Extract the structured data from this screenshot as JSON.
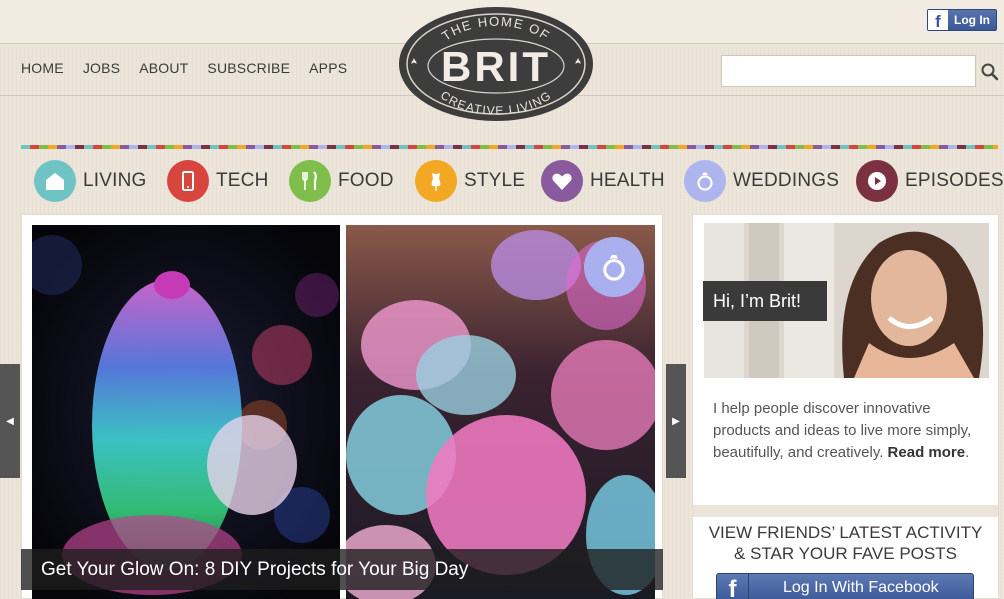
{
  "header": {
    "fb_login_label": "Log In",
    "nav": [
      "HOME",
      "JOBS",
      "ABOUT",
      "SUBSCRIBE",
      "APPS"
    ],
    "logo": {
      "top": "THE HOME OF",
      "main": "BRIT",
      "bottom": "CREATIVE LIVING"
    },
    "search": {
      "value": "",
      "placeholder": ""
    }
  },
  "categories": [
    {
      "label": "LIVING",
      "color": "#6fc3c5",
      "icon": "house-icon"
    },
    {
      "label": "TECH",
      "color": "#d8453e",
      "icon": "phone-icon"
    },
    {
      "label": "FOOD",
      "color": "#7fbe4a",
      "icon": "fork-knife-icon"
    },
    {
      "label": "STYLE",
      "color": "#f3a823",
      "icon": "dress-form-icon"
    },
    {
      "label": "HEALTH",
      "color": "#8a5a9e",
      "icon": "heart-icon"
    },
    {
      "label": "WEDDINGS",
      "color": "#aeb5ee",
      "icon": "ring-icon"
    },
    {
      "label": "EPISODES",
      "color": "#7b3141",
      "icon": "play-icon"
    }
  ],
  "feature": {
    "caption": "Get Your Glow On: 8 DIY Projects for Your Big Day",
    "badge_icon": "ring-icon"
  },
  "sidebar": {
    "hi": "Hi, I’m Brit!",
    "intro": "I help people discover innovative products and ideas to live more simply, beautifully, and creatively.",
    "read_more": "Read more",
    "read_more_suffix": ".",
    "activity_line1": "VIEW FRIENDS’ LATEST ACTIVITY",
    "activity_line2": "& STAR YOUR FAVE POSTS",
    "fb_button": "Log In With Facebook"
  }
}
